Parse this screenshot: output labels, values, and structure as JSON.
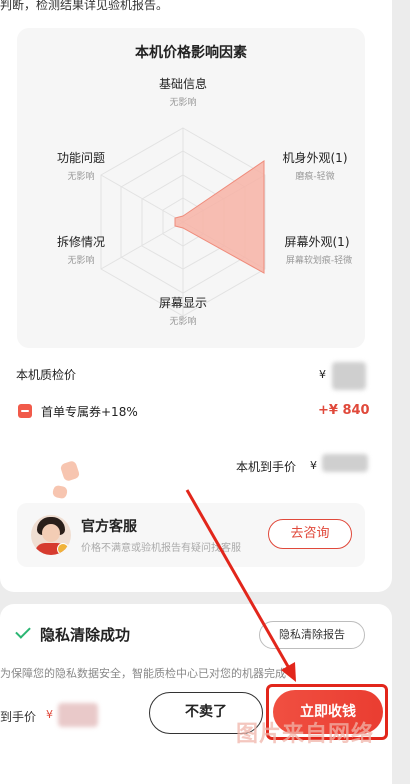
{
  "intro_text": "判断，检测结果详见验机报告。",
  "radar": {
    "title": "本机价格影响因素",
    "dimensions": [
      {
        "name": "基础信息",
        "impact": "无影响"
      },
      {
        "name": "机身外观(1)",
        "impact": "磨痕-轻微"
      },
      {
        "name": "屏幕外观(1)",
        "impact": "屏幕软划痕-轻微"
      },
      {
        "name": "屏幕显示",
        "impact": "无影响"
      },
      {
        "name": "拆修情况",
        "impact": "无影响"
      },
      {
        "name": "功能问题",
        "impact": "无影响"
      }
    ]
  },
  "price": {
    "inspection_label": "本机质检价",
    "yen": "¥",
    "coupon_text": "首单专属券+18%",
    "coupon_value": "+¥ 840",
    "received_label": "本机到手价"
  },
  "service": {
    "title": "官方客服",
    "subtitle": "价格不满意或验机报告有疑问找客服",
    "button": "去咨询"
  },
  "privacy": {
    "title": "隐私清除成功",
    "report_button": "隐私清除报告",
    "description": "为保障您的隐私数据安全，智能质检中心已对您的机器完成"
  },
  "bottom": {
    "price_label": "到手价",
    "yen": "¥",
    "no_sell_button": "不卖了",
    "collect_button": "立即收钱"
  },
  "watermark": "图片来自网络",
  "colors": {
    "accent": "#e0493b",
    "success": "#2bb673"
  }
}
